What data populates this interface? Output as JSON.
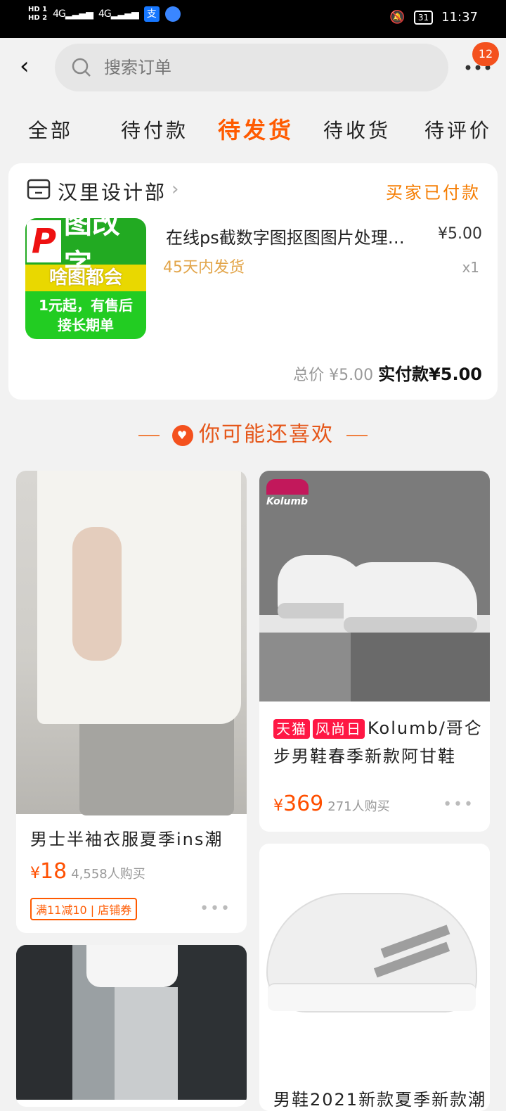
{
  "status_bar": {
    "network_1": "4G",
    "network_2": "4G",
    "alipay_icon": "支",
    "battery": "31",
    "time": "11:37"
  },
  "search": {
    "placeholder": "搜索订单",
    "badge_count": "12"
  },
  "tabs": [
    {
      "label": "全部"
    },
    {
      "label": "待付款"
    },
    {
      "label": "待发货"
    },
    {
      "label": "待收货"
    },
    {
      "label": "待评价"
    }
  ],
  "order": {
    "shop_name": "汉里设计部",
    "status": "买家已付款",
    "product_title": "在线ps截数字图抠图图片处理…",
    "price": "¥5.00",
    "ship_note": "45天内发货",
    "quantity": "x1",
    "total_label": "总价",
    "total_value": "¥5.00",
    "paid_label": "实付款",
    "paid_value": "¥5.00",
    "image_text": {
      "letter": "P",
      "line1": "图改字",
      "line2": "啥图都会",
      "line3": "1元起，有售后",
      "line4": "接长期单"
    }
  },
  "recommend": {
    "title": "你可能还喜欢",
    "items": [
      {
        "title": "男士半袖衣服夏季ins潮",
        "price_symbol": "¥",
        "price": "18",
        "buyers": "4,558人购买",
        "coupon": "满11减10 | 店铺券"
      },
      {
        "brand_logo": "Kolumb",
        "tag1": "天猫",
        "tag2": "风尚日",
        "title_line1": "Kolumb/哥仑",
        "title_line2": "步男鞋春季新款阿甘鞋",
        "price_symbol": "¥",
        "price": "369",
        "buyers": "271人购买"
      },
      {
        "title": "男鞋2021新款夏季新款潮"
      },
      {
        "title": ""
      }
    ]
  }
}
